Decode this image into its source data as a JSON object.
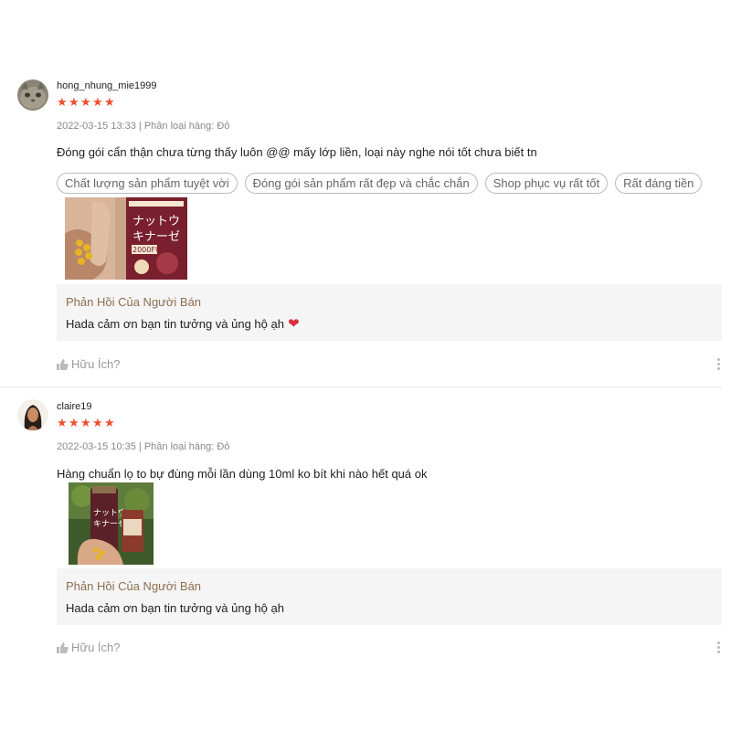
{
  "reviews": [
    {
      "username": "hong_nhung_mie1999",
      "rating": 5,
      "meta": "2022-03-15 13:33 | Phân loại hàng: Đỏ",
      "comment": "Đóng gói cẩn thận chưa từng thấy luôn @@ mấy lớp liền, loại này nghe nói tốt chưa biết tn",
      "tags": [
        "Chất lượng sản phẩm tuyệt vời",
        "Đóng gói sản phẩm rất đẹp và chắc chắn",
        "Shop phục vụ rất tốt",
        "Rất đáng tiền"
      ],
      "photo_text": {
        "line1": "ナットウ",
        "line2": "キナーゼ",
        "line3": "2000FU"
      },
      "reply_title": "Phản Hồi Của Người Bán",
      "reply_text": "Hada cảm ơn bạn tin tưởng và ủng hộ ạh",
      "reply_emoji": "heart-icon",
      "helpful_label": "Hữu Ích?"
    },
    {
      "username": "claire19",
      "rating": 5,
      "meta": "2022-03-15 10:35 | Phân loại hàng: Đỏ",
      "comment": "Hàng chuẩn lọ to bự đùng mỗi lần dùng 10ml ko bít khi nào hết quá ok",
      "photo_text": {
        "line1": "ナットウ",
        "line2": "キナーゼ"
      },
      "reply_title": "Phản Hồi Của Người Bán",
      "reply_text": "Hada cảm ơn bạn tin tưởng và ủng hộ ạh",
      "helpful_label": "Hữu Ích?"
    }
  ],
  "colors": {
    "star": "#ee4d2d",
    "reply_title": "#8d6e52",
    "reply_bg": "#f5f5f5",
    "heart": "#d9303c"
  }
}
